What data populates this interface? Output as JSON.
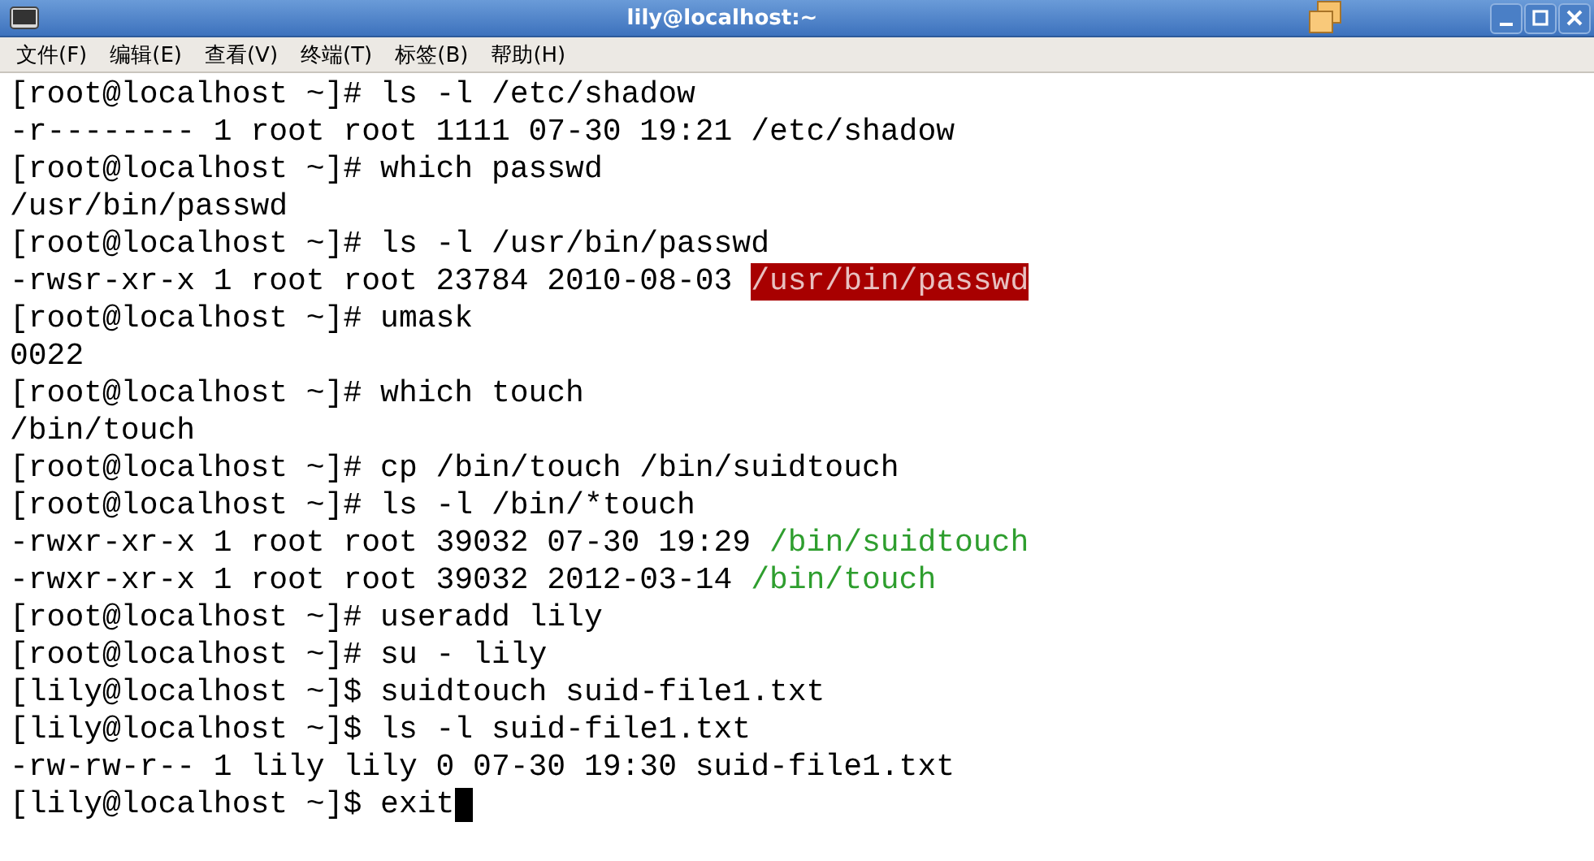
{
  "window": {
    "title": "lily@localhost:~"
  },
  "menu": [
    "文件(F)",
    "编辑(E)",
    "查看(V)",
    "终端(T)",
    "标签(B)",
    "帮助(H)"
  ],
  "terminal": {
    "lines": [
      [
        {
          "text": "[root@localhost ~]# ls -l /etc/shadow",
          "kind": "plain"
        }
      ],
      [
        {
          "text": "-r-------- 1 root root 1111 07-30 19:21 /etc/shadow",
          "kind": "plain"
        }
      ],
      [
        {
          "text": "[root@localhost ~]# which passwd",
          "kind": "plain"
        }
      ],
      [
        {
          "text": "/usr/bin/passwd",
          "kind": "plain"
        }
      ],
      [
        {
          "text": "[root@localhost ~]# ls -l /usr/bin/passwd",
          "kind": "plain"
        }
      ],
      [
        {
          "text": "-rwsr-xr-x 1 root root 23784 2010-08-03 ",
          "kind": "plain"
        },
        {
          "text": "/usr/bin/passwd",
          "kind": "suid"
        }
      ],
      [
        {
          "text": "[root@localhost ~]# umask",
          "kind": "plain"
        }
      ],
      [
        {
          "text": "0022",
          "kind": "plain"
        }
      ],
      [
        {
          "text": "[root@localhost ~]# which touch",
          "kind": "plain"
        }
      ],
      [
        {
          "text": "/bin/touch",
          "kind": "plain"
        }
      ],
      [
        {
          "text": "[root@localhost ~]# cp /bin/touch /bin/suidtouch",
          "kind": "plain"
        }
      ],
      [
        {
          "text": "[root@localhost ~]# ls -l /bin/*touch",
          "kind": "plain"
        }
      ],
      [
        {
          "text": "-rwxr-xr-x 1 root root 39032 07-30 19:29 ",
          "kind": "plain"
        },
        {
          "text": "/bin/suidtouch",
          "kind": "exec"
        }
      ],
      [
        {
          "text": "-rwxr-xr-x 1 root root 39032 2012-03-14 ",
          "kind": "plain"
        },
        {
          "text": "/bin/touch",
          "kind": "exec"
        }
      ],
      [
        {
          "text": "[root@localhost ~]# useradd lily",
          "kind": "plain"
        }
      ],
      [
        {
          "text": "[root@localhost ~]# su - lily",
          "kind": "plain"
        }
      ],
      [
        {
          "text": "[lily@localhost ~]$ suidtouch suid-file1.txt",
          "kind": "plain"
        }
      ],
      [
        {
          "text": "[lily@localhost ~]$ ls -l suid-file1.txt",
          "kind": "plain"
        }
      ],
      [
        {
          "text": "-rw-rw-r-- 1 lily lily 0 07-30 19:30 suid-file1.txt",
          "kind": "plain"
        }
      ],
      [
        {
          "text": "[lily@localhost ~]$ exit",
          "kind": "plain"
        }
      ]
    ],
    "cursor": true
  }
}
